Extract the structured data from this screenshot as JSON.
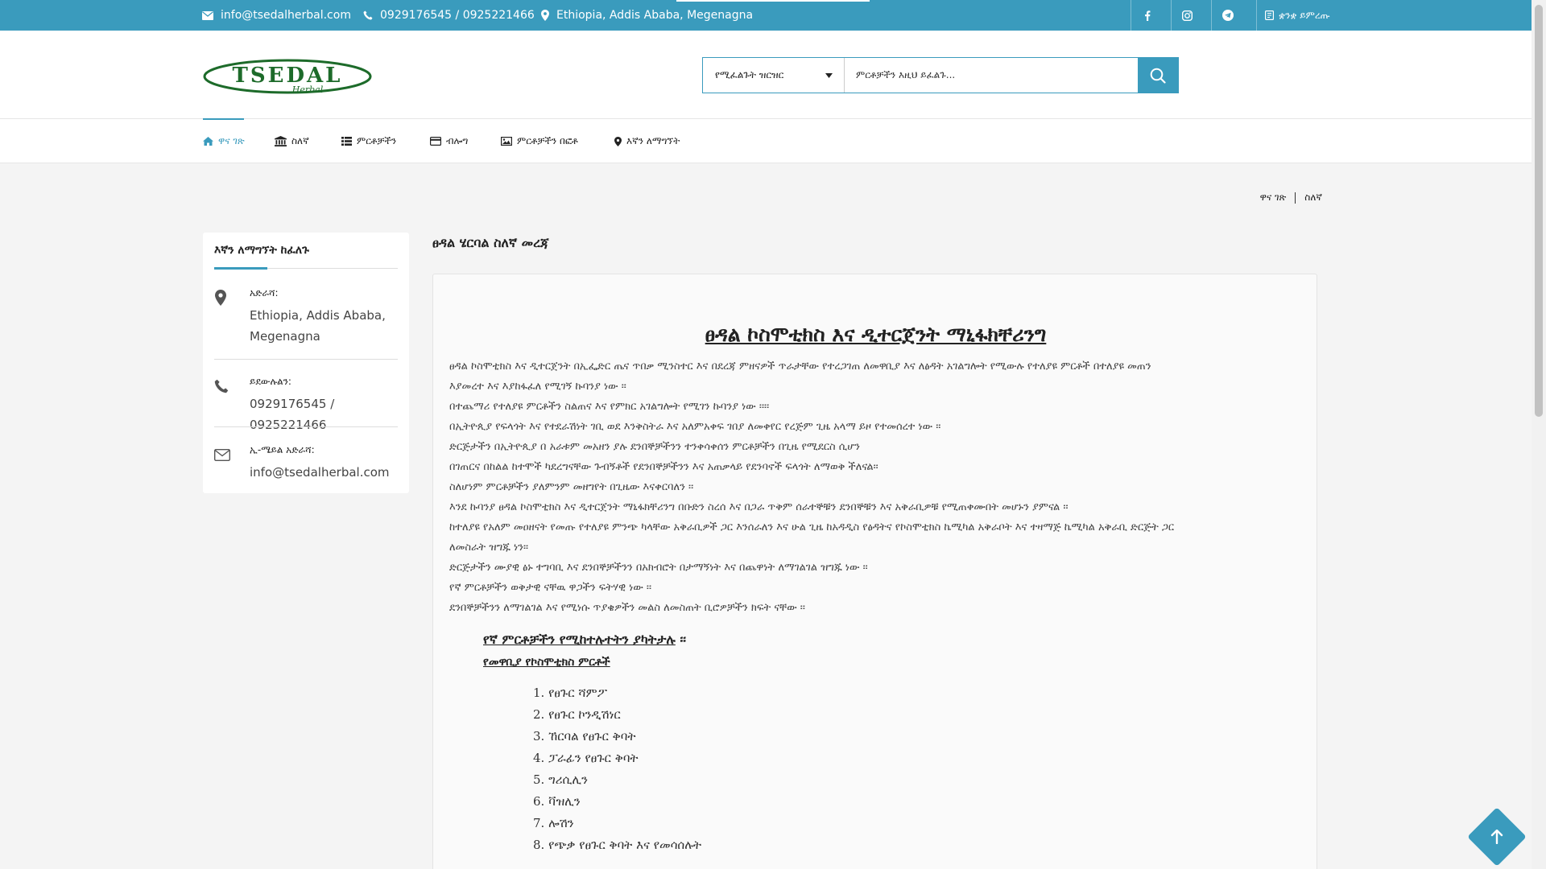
{
  "topbar": {
    "email": "info@tsedalherbal.com",
    "phone": "0929176545 / 0925221466",
    "location": "Ethiopia, Addis Ababa, Megenagna",
    "language": "ቋንቋ ይምረጡ",
    "social_icons": [
      "facebook-icon",
      "instagram-icon",
      "telegram-icon"
    ]
  },
  "header": {
    "logo_text": "TSEDAL",
    "logo_subtext": "Herbal",
    "search": {
      "category_label": "የሚፈልጉት ዝርዝር",
      "placeholder": "ምርቶቻችን እዚህ ይፈልጉ..."
    }
  },
  "nav": {
    "items": [
      {
        "label": "ዋና ገጽ",
        "icon": "home-icon",
        "active": true
      },
      {
        "label": "ስለኛ",
        "icon": "institution-icon",
        "active": false
      },
      {
        "label": "ምርቶቻችን",
        "icon": "list-icon",
        "active": false
      },
      {
        "label": "ብሎግ",
        "icon": "card-icon",
        "active": false
      },
      {
        "label": "ምርቶቻችን በፎቶ",
        "icon": "image-icon",
        "active": false
      },
      {
        "label": "እኛን ለማግኘት",
        "icon": "map-marker-icon",
        "active": false
      }
    ]
  },
  "breadcrumb": {
    "home": "ዋና ገጽ",
    "current": "ስለኛ"
  },
  "sidebar": {
    "title": "እኛን ለማግኘት ከፈለጉ",
    "address_label": "አድራሻ:",
    "address_line1": "Ethiopia, Addis Ababa,",
    "address_line2": "Megenagna",
    "phone_label": "ይደውሉልን:",
    "phone_value": "0929176545 / 0925221466",
    "email_label": "ኢ-ሜይል አድራሻ:",
    "email_value": "info@tsedalherbal.com"
  },
  "main": {
    "title": "ፀዳል ሄርባል ስለኛ መረጃ",
    "heading": "ፀዳል ኮስሞቲክስ እና ዲተርጀንት ማኒፋክቸሪንግ",
    "paragraphs": [
      "ፀዳል  ኮስሞቲክስ እና ዲተርጀንት በኢፌድር ጤና ጥበቃ ሚንስተር  እና በደረጃ ምዘናዎች ጥራታቸው የተረጋገጠ  ለመዋቢያ  እና ለፅዳት አገልግሎት የሚውሉ የተለያዩ ምርቶች በተለያዩ  መጠን",
      "እያመረተ እና እያከፋፈለ የሚገኝ ኩባንያ ነው ፡፡",
      "በተጨማሪ የተለያዩ ምርቶችን ስልጠና  እና የምክር አገልግሎት የሚገን ኩባንያ ነው ፡፡፡፡",
      "በኢትዮጲያ  የፍላጎት እና የተደራሽነት ገቢ ወደ እንቅስትራ  እና  አለምአቀፍ ገበያ ለመቀየር የረጅም ጊዜ አላማ ይዞ የተመሰረተ ነው ፡፡",
      "ድርጅታችን በኢትዮጲያ በ አራቱም መአዘን ያሉ ደንበኞቻችንን ተንቀሳቀሰን ምርቶቻችን በጊዜ የሚደርስ ሲሆን",
      "በገጠርና በከልል ከተሞች ካደረግናቸው ጉብኝቶች የደንበኞቻችንን እና አጠቃላይ የደንባኖች  ፍላጎት ለማወቅ ችለናል፡፡",
      "ስለሆነም  ምርቶቻችን ያለምንም መዘግየት በጊዜው እናቀርባለን ፡፡",
      " እንደ ኩባንያ ፀዳል ኮስሞቲክስ እና ዲተርጀንት ማኒፋክቸሪንግ  በቡድን  ስረሰ እና በጋራ ጥቅም ሰራተኞቹን  ደንበኞቹን እና አቅራቢዎቹ  የሚጠቀሙበት መሆኑን ያምናል ፡፡",
      "ከተለያዩ የአለም መዐዘናት የመጡ የተለያዩ ምንጭ ካላቸው አቅራቢዎች ጋር እንሰራለን  እና ሁል ጊዜ ከአዳዲስ የፅዳትና የኮስሞቲክስ ኬሚካል አቅራቦት እና ተዛማጅ ኬሚካል አቅራቢ ድርጅት ጋር",
      "ለመስራት ዝግጁ ነን፡፡",
      "ድርጅታችን ሙያዊ ፅኑ ተግባቢ እና ደንበኞቻችንን በአክብሮት በታማኝነት እና በጨዋነት ለማገልገል ዝግጁ  ነው ፡፡",
      "የኛ ምርቶቻችን ወቅታዊ ናቸዉ ዋጋችን ፍትሃዊ ነው ፡፡",
      "ደንበኞቻችንን ለማገልገል እና የሚነሱ ጥያቄዎችን መልስ ለመስጠት ቢሮዎቻችን ክፍት ናቸው ፡፡"
    ],
    "subheading1": "የኛ ምርቶቻችን የሚከተሉተትን ያካትታሉ",
    "subheading1_suffix": " ፡፡",
    "subheading2": "የመዋቢያ የኮስሞቲክስ ምርቶች",
    "products": [
      "1. የፀጉር ሻምፖ",
      "2. የፀጉር ኮንዲሽነር",
      "3. ኸርባል የፀጉር ቅባት",
      "4. ፓራፊን የፀጉር ቅባት",
      "5.  ግሪሲሊን",
      "6. ቫዝሊን",
      "7. ሎሽን",
      "8. የጭቃ የፀጉር ቅባት እና የመሳሰሉት"
    ]
  },
  "colors": {
    "accent": "#3a9bbd",
    "logo_green": "#1d6b2a"
  }
}
